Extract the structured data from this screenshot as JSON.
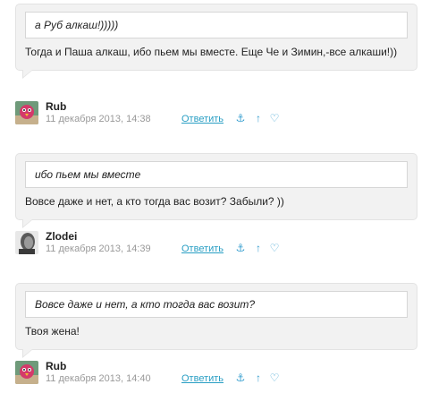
{
  "comments": [
    {
      "quote": "а Руб алкаш!)))))",
      "text": "Тогда и Паша алкаш, ибо пьем мы вместе. Еще Че и Зимин,-все алкаши!))",
      "author": "Rub",
      "date": "11 декабря 2013, 14:38",
      "reply_label": "Ответить",
      "avatar": "pink-bird-avatar"
    },
    {
      "quote": "ибо пьем мы вместе",
      "text": "Вовсе даже и нет, а кто тогда вас возит? Забыли? ))",
      "author": "Zlodei",
      "date": "11 декабря 2013, 14:39",
      "reply_label": "Ответить",
      "avatar": "grayscale-face-avatar"
    },
    {
      "quote": "Вовсе даже и нет, а кто тогда вас возит?",
      "text": "Твоя жена!",
      "author": "Rub",
      "date": "11 декабря 2013, 14:40",
      "reply_label": "Ответить",
      "avatar": "pink-bird-avatar"
    }
  ],
  "icons": {
    "anchor": "⚓",
    "up": "↑",
    "heart": "♡"
  },
  "colors": {
    "bubble_bg": "#f2f2f2",
    "link": "#2a9fc4",
    "icon": "#3aa0d0",
    "date": "#999999"
  }
}
